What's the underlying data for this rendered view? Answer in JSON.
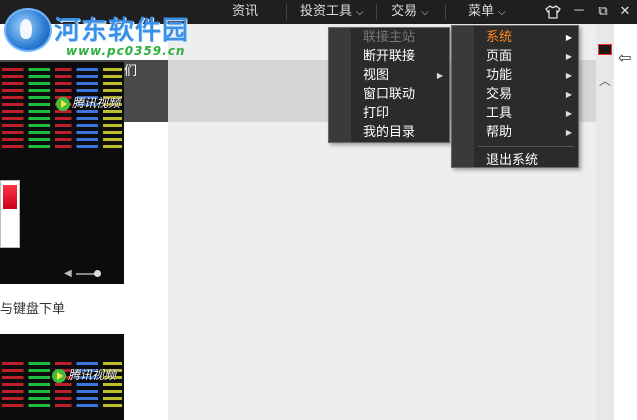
{
  "logo": {
    "name": "河东软件园",
    "url": "www.pc0359.cn"
  },
  "topnav": {
    "news": "资讯",
    "invest_tools": "投资工具",
    "trade": "交易",
    "menu": "菜单"
  },
  "window": {
    "skin_icon": "tshirt-icon",
    "minimize": "－",
    "restore": "⧉",
    "close": "✕"
  },
  "left": {
    "partial_text": "们",
    "video_badge": "腾讯视频",
    "caption": "与键盘下单"
  },
  "main_menu": {
    "items": [
      {
        "label": "系统",
        "has_sub": true,
        "active": true
      },
      {
        "label": "页面",
        "has_sub": true
      },
      {
        "label": "功能",
        "has_sub": true
      },
      {
        "label": "交易",
        "has_sub": true
      },
      {
        "label": "工具",
        "has_sub": true
      },
      {
        "label": "帮助",
        "has_sub": true
      }
    ],
    "exit": "退出系统"
  },
  "system_submenu": {
    "items": [
      {
        "label": "联接主站",
        "disabled": true
      },
      {
        "label": "断开联接"
      },
      {
        "label": "视图",
        "has_sub": true
      },
      {
        "label": "窗口联动"
      },
      {
        "label": "打印"
      },
      {
        "label": "我的目录"
      }
    ]
  },
  "colors": {
    "titlebar": "#1f1f1f",
    "menu_bg": "#2b2b2b",
    "active": "#ff8c1a",
    "logo_blue": "#3a8fe6",
    "logo_green": "#2fae3b"
  }
}
